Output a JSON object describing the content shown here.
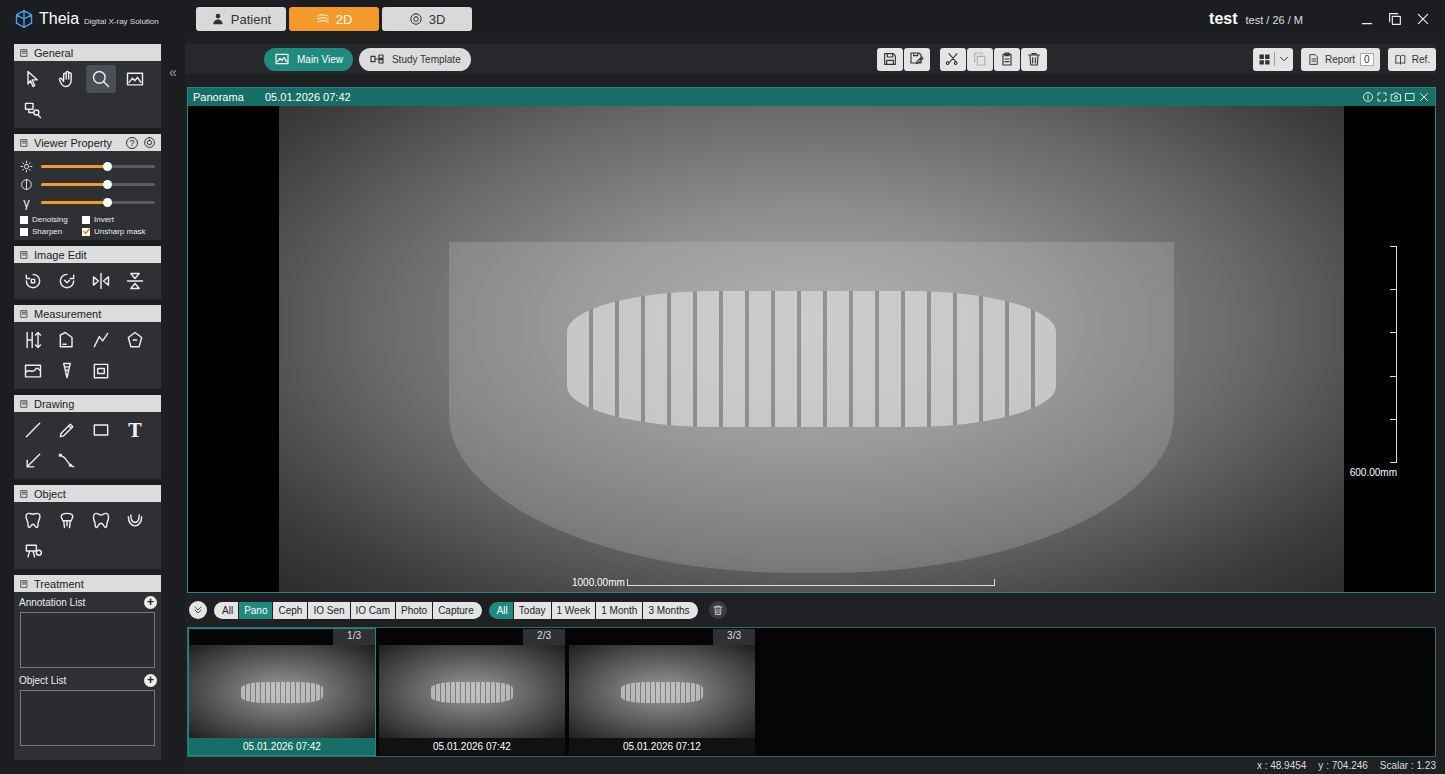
{
  "app": {
    "logo_title": "Theia",
    "logo_subtitle": "Digital X-ray Solution"
  },
  "mode_tabs": [
    {
      "label": "Patient",
      "selected": false
    },
    {
      "label": "2D",
      "selected": true
    },
    {
      "label": "3D",
      "selected": false
    }
  ],
  "patient": {
    "name": "test",
    "info": "test / 26 / M"
  },
  "sidebar": {
    "collapse": "«",
    "panels": [
      {
        "title": "General",
        "kind": "tools",
        "tools": [
          {
            "selected": false
          },
          {
            "selected": false
          },
          {
            "selected": true
          },
          {
            "selected": false
          },
          {
            "selected": false
          }
        ]
      },
      {
        "title": "Viewer Property",
        "kind": "properties",
        "help": "?",
        "sliders": [
          {
            "level": 0.58
          },
          {
            "level": 0.58
          },
          {
            "symbol": "γ",
            "level": 0.58
          }
        ],
        "options": [
          {
            "label": "Denoising",
            "checked": false
          },
          {
            "label": "Invert",
            "checked": false
          },
          {
            "label": "Sharpen",
            "checked": false
          },
          {
            "label": "Unsharp mask",
            "checked": true
          }
        ]
      },
      {
        "title": "Image Edit",
        "kind": "tools",
        "tools": [
          {
            "selected": false
          },
          {
            "selected": false
          },
          {
            "selected": false
          },
          {
            "selected": false
          }
        ]
      },
      {
        "title": "Measurement",
        "kind": "tools",
        "tools": [
          {
            "selected": false
          },
          {
            "selected": false
          },
          {
            "selected": false
          },
          {
            "selected": false
          },
          {
            "selected": false
          },
          {
            "selected": false
          },
          {
            "selected": false
          }
        ]
      },
      {
        "title": "Drawing",
        "kind": "tools",
        "tools": [
          {
            "selected": false
          },
          {
            "selected": false
          },
          {
            "selected": false
          },
          {
            "selected": false,
            "glyph": "T"
          },
          {
            "selected": false
          },
          {
            "selected": false
          }
        ]
      },
      {
        "title": "Object",
        "kind": "tools",
        "tools": [
          {
            "selected": false
          },
          {
            "selected": false
          },
          {
            "selected": false
          },
          {
            "selected": false
          },
          {
            "selected": false
          }
        ]
      },
      {
        "title": "Treatment",
        "kind": "lists",
        "lists": [
          {
            "label": "Annotation List",
            "add": "+"
          },
          {
            "label": "Object List",
            "add": "+"
          }
        ]
      }
    ]
  },
  "view_tabs": [
    {
      "label": "Main View",
      "selected": true
    },
    {
      "label": "Study Template",
      "selected": false
    }
  ],
  "actions": [
    {
      "disabled": false
    },
    {
      "disabled": false
    },
    {
      "disabled": false
    },
    {
      "disabled": true
    },
    {
      "disabled": false
    },
    {
      "disabled": false
    }
  ],
  "report": {
    "label": "Report",
    "count": "0"
  },
  "ref": {
    "label": "Ref."
  },
  "viewer": {
    "title": "Panorama",
    "timestamp": "05.01.2026 07:42",
    "scale_vertical": "600.00mm",
    "scale_horizontal": "1000.00mm"
  },
  "modality_filters": [
    {
      "label": "All",
      "selected": false
    },
    {
      "label": "Pano",
      "selected": true
    },
    {
      "label": "Ceph",
      "selected": false
    },
    {
      "label": "IO Sen",
      "selected": false
    },
    {
      "label": "IO Cam",
      "selected": false
    },
    {
      "label": "Photo",
      "selected": false
    },
    {
      "label": "Capture",
      "selected": false
    }
  ],
  "period_filters": [
    {
      "label": "All",
      "selected": true
    },
    {
      "label": "Today",
      "selected": false
    },
    {
      "label": "1 Week",
      "selected": false
    },
    {
      "label": "1 Month",
      "selected": false
    },
    {
      "label": "3 Months",
      "selected": false
    }
  ],
  "thumbnails": [
    {
      "index": "1/3",
      "date": "05.01.2026 07:42",
      "selected": true
    },
    {
      "index": "2/3",
      "date": "05.01.2026 07:42",
      "selected": false
    },
    {
      "index": "3/3",
      "date": "05.01.2026 07:12",
      "selected": false
    }
  ],
  "status_bar": {
    "x": "x : 48.9454",
    "y": "y : 704.246",
    "scalar": "Scalar : 1.23"
  }
}
